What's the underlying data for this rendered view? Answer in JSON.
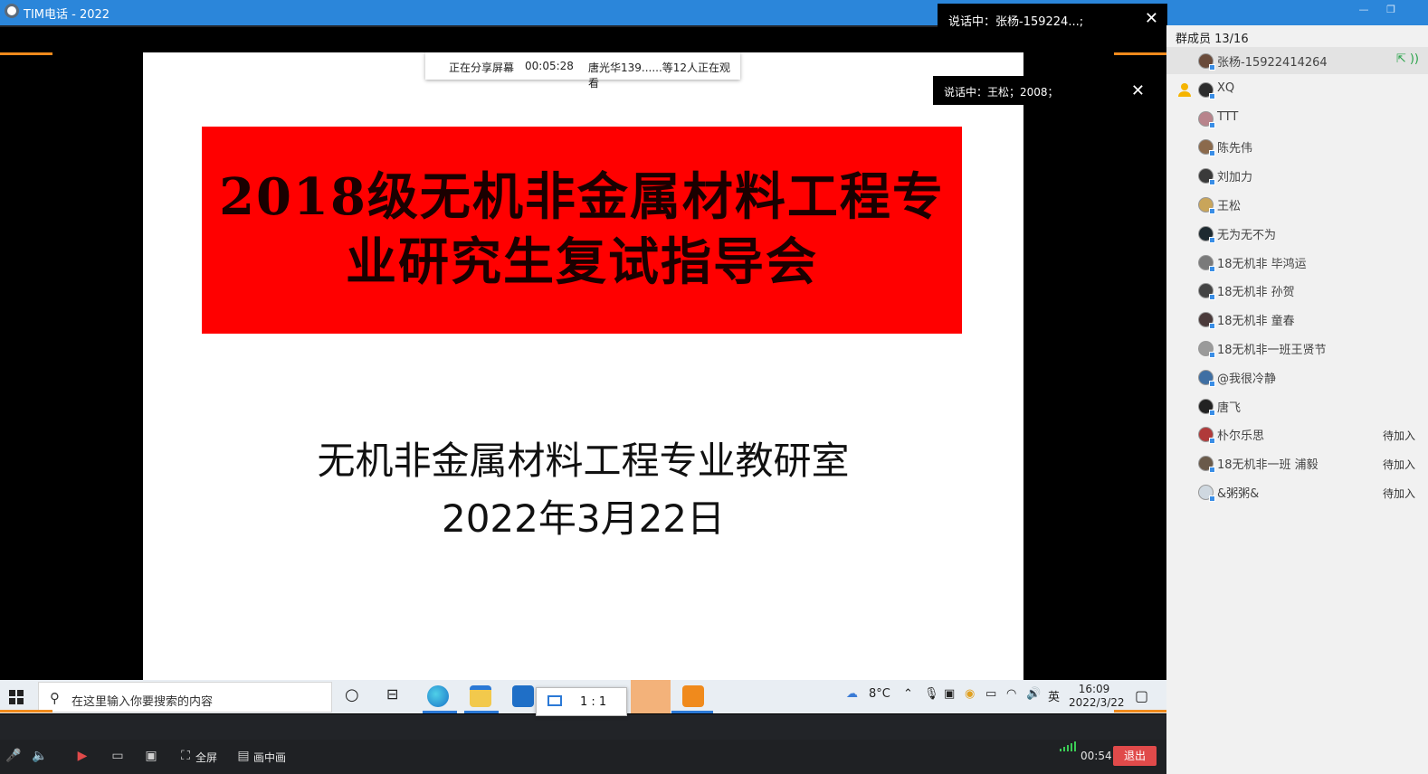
{
  "titlebar": {
    "title": "TIM电话 - 2022"
  },
  "speaking_top": {
    "text": "说话中：张杨-159224...;"
  },
  "speaking_mid": {
    "text": "说话中：王松；2008；"
  },
  "share_bar": {
    "status": "正在分享屏幕",
    "elapsed": "00:05:28",
    "viewers": "唐光华139......等12人正在观看"
  },
  "slide": {
    "title_line1": "2018级无机非金属材料工程专",
    "title_line2": "业研究生复试指导会",
    "department": "无机非金属材料工程专业教研室",
    "date": "2022年3月22日"
  },
  "taskbar": {
    "search_placeholder": "在这里输入你要搜索的内容",
    "ratio": "1 : 1",
    "weather": "8°C",
    "ime": "英",
    "time": "16:09",
    "date": "2022/3/22"
  },
  "panel": {
    "header": "群成员 13/16",
    "pending_label": "待加入",
    "members": [
      {
        "name": "张杨-15922414264",
        "selected": true,
        "color": "#6a4b3a"
      },
      {
        "name": "XQ",
        "host": true,
        "color": "#2d2d2d"
      },
      {
        "name": "TTT",
        "color": "#b8848c"
      },
      {
        "name": "陈先伟",
        "color": "#8b6a4c"
      },
      {
        "name": "刘加力",
        "color": "#3a3a3a"
      },
      {
        "name": "王松",
        "color": "#c9a55a"
      },
      {
        "name": "无为无不为",
        "color": "#1e2a30"
      },
      {
        "name": "18无机非 毕鸿运",
        "color": "#7a7a7a"
      },
      {
        "name": "18无机非 孙贺",
        "color": "#444"
      },
      {
        "name": "18无机非 童春",
        "color": "#4a3a3a"
      },
      {
        "name": "18无机非一班王贤节",
        "color": "#9a9a9a"
      },
      {
        "name": "@我很冷静",
        "color": "#3f6fa3"
      },
      {
        "name": "唐飞",
        "color": "#222"
      },
      {
        "name": "朴尔乐思",
        "pending": true,
        "color": "#b03a3a"
      },
      {
        "name": "18无机非一班 浦毅",
        "pending": true,
        "color": "#6a5a4a"
      },
      {
        "name": "&粥粥&",
        "pending": true,
        "color": "#cfd8e0"
      }
    ]
  },
  "bottombar": {
    "fullscreen": "全屏",
    "pip": "画中画",
    "duration": "00:54",
    "exit": "退出"
  },
  "colors": {
    "accent": "#2b86da",
    "orange": "#f08a1c",
    "exit": "#e04a4a",
    "slide_red": "#ff0000"
  }
}
